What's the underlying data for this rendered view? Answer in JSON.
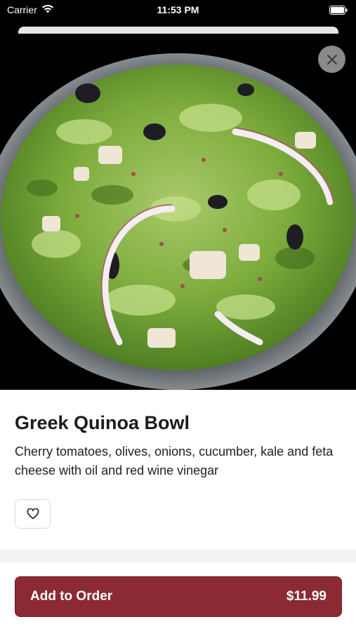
{
  "status_bar": {
    "carrier": "Carrier",
    "time": "11:53 PM",
    "wifi_icon": "wifi-icon",
    "battery_icon": "battery-icon"
  },
  "product": {
    "title": "Greek Quinoa Bowl",
    "description": "Cherry tomatoes, olives, onions, cucumber, kale and feta cheese with oil and red wine vinegar",
    "image_icon": "salad-bowl-image",
    "favorite_icon": "heart-icon",
    "close_icon": "close-icon"
  },
  "order": {
    "add_label": "Add to Order",
    "price": "$11.99"
  },
  "colors": {
    "accent": "#8b2a32",
    "close_bg": "#8a8a8a"
  }
}
